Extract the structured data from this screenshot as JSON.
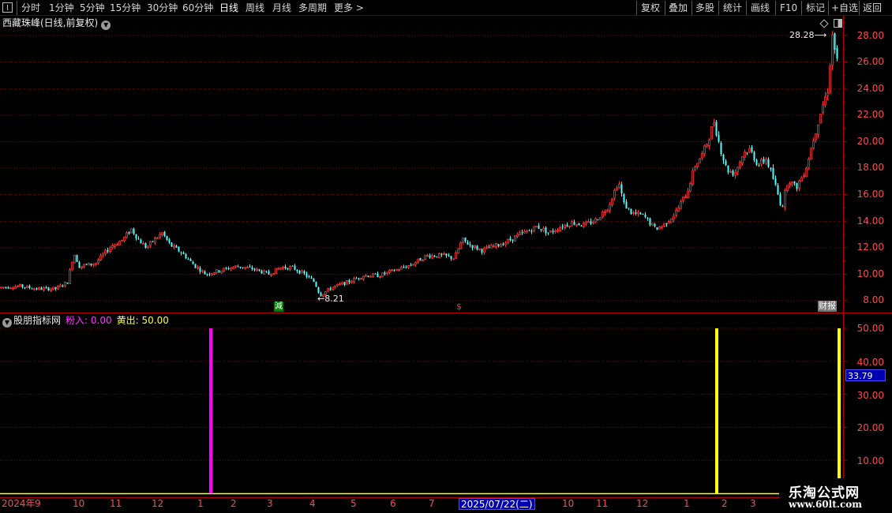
{
  "toolbar": {
    "periods": [
      "分时",
      "1分钟",
      "5分钟",
      "15分钟",
      "30分钟",
      "60分钟",
      "日线",
      "周线",
      "月线",
      "多周期",
      "更多 >"
    ],
    "active_period": "日线",
    "actions": [
      "复权",
      "叠加",
      "多股",
      "统计",
      "画线",
      "F10",
      "标记",
      "+自选",
      "返回"
    ]
  },
  "price_chart": {
    "title": "西藏珠峰(日线,前复权)",
    "y_ticks": [
      "28.00",
      "26.00",
      "24.00",
      "22.00",
      "20.00",
      "18.00",
      "16.00",
      "14.00",
      "12.00",
      "10.00",
      "8.00"
    ],
    "low_marker": "8.21",
    "high_marker": "28.28",
    "events": {
      "jian": "減",
      "s": "$",
      "caibao": "财报"
    }
  },
  "indicator": {
    "name": "股朋指标网",
    "pink_label": "粉入:",
    "pink_value": "0.00",
    "yellow_label": "黄出:",
    "yellow_value": "50.00",
    "y_ticks": [
      "50.00",
      "40.00",
      "30.00",
      "20.00",
      "10.00"
    ],
    "crosshair_value": "33.79"
  },
  "x_axis": {
    "labels": [
      "2024年",
      "9",
      "10",
      "11",
      "12",
      "1",
      "2",
      "3",
      "4",
      "5",
      "6",
      "7",
      "10",
      "11",
      "12",
      "1",
      "2",
      "3"
    ],
    "crosshair_date": "2025/07/22(二)"
  },
  "watermark": {
    "title": "乐淘公式网",
    "url": "www.60lt.com"
  },
  "colors": {
    "up": "#ff3232",
    "down": "#54ffff",
    "grid": "#8a0000",
    "pink": "#ff00ff",
    "yellow": "#ffff00",
    "axis": "#b00000"
  },
  "chart_data": {
    "type": "candlestick",
    "title": "西藏珠峰(日线,前复权)",
    "ylim": [
      7.5,
      29.3
    ],
    "price_path": [
      [
        0,
        9.0
      ],
      [
        25,
        9.1
      ],
      [
        45,
        8.9
      ],
      [
        70,
        8.9
      ],
      [
        85,
        9.4
      ],
      [
        93,
        11.6
      ],
      [
        100,
        10.6
      ],
      [
        120,
        10.8
      ],
      [
        140,
        12.1
      ],
      [
        155,
        12.6
      ],
      [
        166,
        13.4
      ],
      [
        175,
        12.6
      ],
      [
        185,
        12.0
      ],
      [
        195,
        12.6
      ],
      [
        205,
        13.1
      ],
      [
        215,
        12.2
      ],
      [
        230,
        11.6
      ],
      [
        245,
        10.7
      ],
      [
        260,
        10.0
      ],
      [
        280,
        10.3
      ],
      [
        300,
        10.6
      ],
      [
        320,
        10.4
      ],
      [
        340,
        10.0
      ],
      [
        355,
        10.5
      ],
      [
        370,
        10.5
      ],
      [
        385,
        10.0
      ],
      [
        398,
        9.4
      ],
      [
        405,
        8.4
      ],
      [
        420,
        9.0
      ],
      [
        440,
        9.4
      ],
      [
        460,
        9.9
      ],
      [
        480,
        9.9
      ],
      [
        500,
        10.3
      ],
      [
        520,
        10.7
      ],
      [
        540,
        11.4
      ],
      [
        560,
        11.4
      ],
      [
        575,
        11.2
      ],
      [
        585,
        12.6
      ],
      [
        595,
        12.2
      ],
      [
        610,
        11.8
      ],
      [
        625,
        12.1
      ],
      [
        640,
        12.4
      ],
      [
        655,
        12.9
      ],
      [
        670,
        13.3
      ],
      [
        680,
        13.6
      ],
      [
        695,
        13.1
      ],
      [
        710,
        13.6
      ],
      [
        725,
        13.9
      ],
      [
        740,
        13.7
      ],
      [
        755,
        14.1
      ],
      [
        770,
        15.1
      ],
      [
        783,
        17.0
      ],
      [
        790,
        15.3
      ],
      [
        800,
        14.6
      ],
      [
        815,
        14.4
      ],
      [
        830,
        13.4
      ],
      [
        840,
        13.7
      ],
      [
        855,
        14.6
      ],
      [
        870,
        16.2
      ],
      [
        880,
        18.2
      ],
      [
        890,
        19.1
      ],
      [
        897,
        20.2
      ],
      [
        904,
        21.5
      ],
      [
        912,
        19.5
      ],
      [
        920,
        17.9
      ],
      [
        930,
        17.6
      ],
      [
        942,
        19.2
      ],
      [
        950,
        19.4
      ],
      [
        960,
        18.2
      ],
      [
        970,
        18.7
      ],
      [
        978,
        17.4
      ],
      [
        985,
        16.0
      ],
      [
        990,
        15.0
      ],
      [
        998,
        17.2
      ],
      [
        1008,
        16.5
      ],
      [
        1020,
        17.9
      ],
      [
        1030,
        20.2
      ],
      [
        1040,
        22.4
      ],
      [
        1048,
        23.9
      ],
      [
        1054,
        28.0
      ],
      [
        1060,
        26.0
      ],
      [
        1062,
        25.6
      ]
    ],
    "pink_spikes": [
      {
        "x": 267,
        "value": 50
      }
    ],
    "yellow_spikes": [
      {
        "x": 908,
        "value": 50
      },
      {
        "x": 1063,
        "value": 50
      }
    ],
    "indicator_ylim": [
      0,
      52
    ]
  }
}
